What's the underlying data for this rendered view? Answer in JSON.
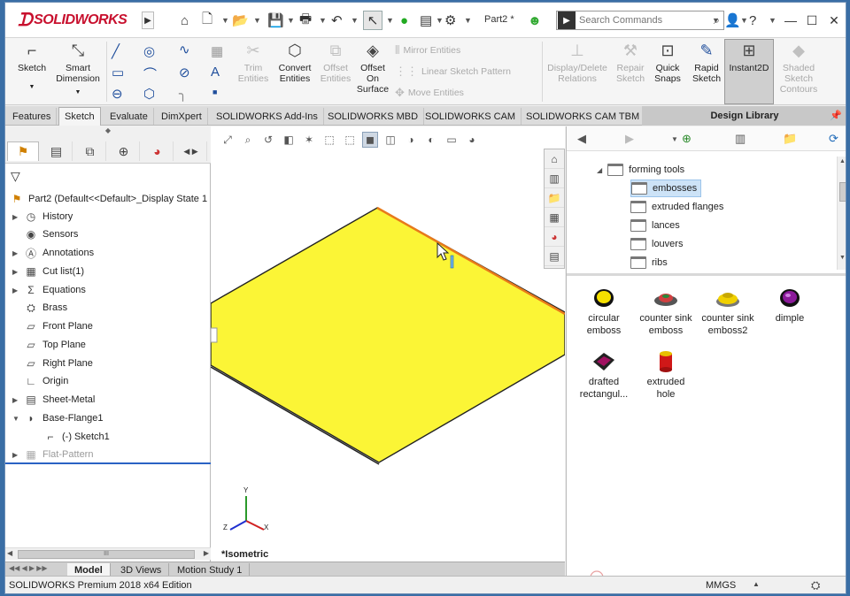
{
  "app": {
    "logo_text": "SOLIDWORKS",
    "document_title": "Part2 *",
    "search_placeholder": "Search Commands"
  },
  "ribbon": {
    "sketch": "Sketch",
    "smart_dimension": "Smart Dimension",
    "trim_entities": "Trim Entities",
    "convert_entities": "Convert Entities",
    "offset_entities": "Offset Entities",
    "offset_on_surface": "Offset On Surface",
    "mirror_entities": "Mirror Entities",
    "linear_sketch_pattern": "Linear Sketch Pattern",
    "move_entities": "Move Entities",
    "display_delete_relations": "Display/Delete Relations",
    "repair_sketch": "Repair Sketch",
    "quick_snaps": "Quick Snaps",
    "rapid_sketch": "Rapid Sketch",
    "instant2d": "Instant2D",
    "shaded_sketch_contours": "Shaded Sketch Contours"
  },
  "command_tabs": [
    "Features",
    "Sketch",
    "Evaluate",
    "DimXpert",
    "SOLIDWORKS Add-Ins",
    "SOLIDWORKS MBD",
    "SOLIDWORKS CAM",
    "SOLIDWORKS CAM TBM"
  ],
  "design_library_tab": "Design Library",
  "feature_tree": {
    "root": "Part2  (Default<<Default>_Display State 1",
    "items": [
      "History",
      "Sensors",
      "Annotations",
      "Cut list(1)",
      "Equations",
      "Brass",
      "Front Plane",
      "Top Plane",
      "Right Plane",
      "Origin",
      "Sheet-Metal",
      "Base-Flange1",
      "(-) Sketch1",
      "Flat-Pattern"
    ],
    "scrollbar_grip": "III"
  },
  "viewport": {
    "view_label": "*Isometric",
    "axes": {
      "x": "X",
      "y": "Y",
      "z": "Z"
    }
  },
  "bottom_tabs": [
    "Model",
    "3D Views",
    "Motion Study 1"
  ],
  "design_library": {
    "tree": [
      "forming tools",
      "embosses",
      "extruded flanges",
      "lances",
      "louvers",
      "ribs"
    ],
    "items": [
      {
        "line1": "circular",
        "line2": "emboss",
        "color": "#f5e000"
      },
      {
        "line1": "counter sink",
        "line2": "emboss",
        "color": "#d04040"
      },
      {
        "line1": "counter sink",
        "line2": "emboss2",
        "color": "#f0d000"
      },
      {
        "line1": "dimple",
        "line2": "",
        "color": "#8b1a9a"
      },
      {
        "line1": "drafted",
        "line2": "rectangul...",
        "color": "#a01060"
      },
      {
        "line1": "extruded",
        "line2": "hole",
        "color": "#e8c000"
      }
    ]
  },
  "status": {
    "edition": "SOLIDWORKS Premium 2018 x64 Edition",
    "units": "MMGS"
  }
}
